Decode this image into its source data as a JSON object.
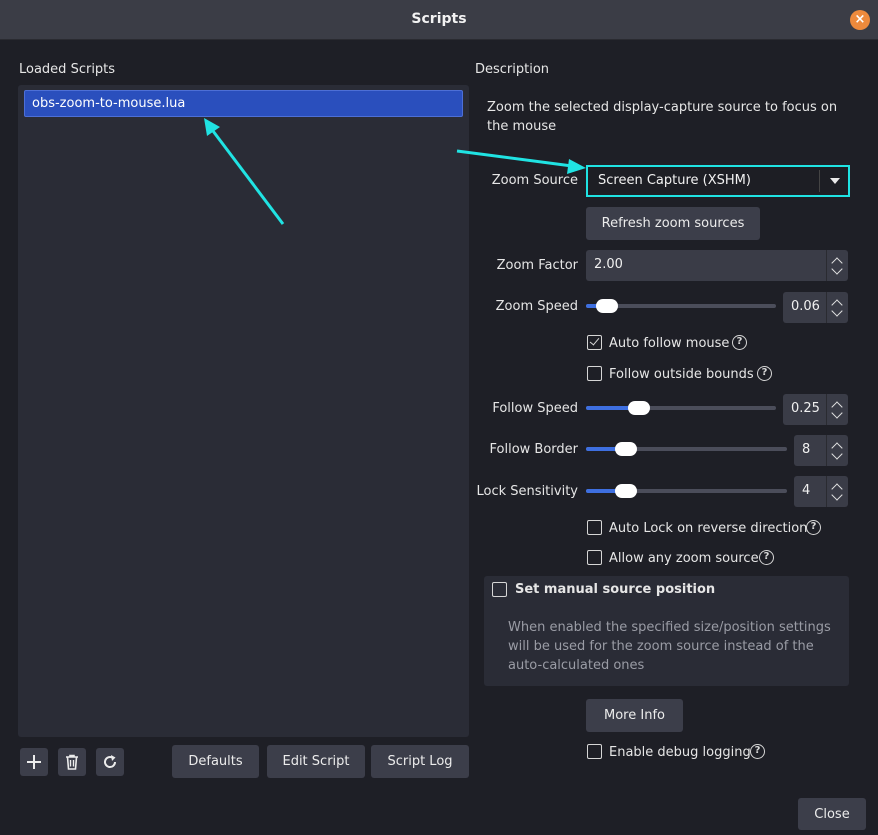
{
  "window": {
    "title": "Scripts",
    "close_glyph": "×"
  },
  "loaded_scripts": {
    "label": "Loaded Scripts",
    "items": [
      {
        "name": "obs-zoom-to-mouse.lua",
        "selected": true
      }
    ]
  },
  "toolbar": {
    "add_icon": "plus-icon",
    "remove_icon": "trash-icon",
    "reload_icon": "reload-icon",
    "defaults_label": "Defaults",
    "edit_script_label": "Edit Script",
    "script_log_label": "Script Log"
  },
  "description": {
    "label": "Description",
    "text": "Zoom the selected display-capture source to focus on the mouse"
  },
  "settings": {
    "zoom_source": {
      "label": "Zoom Source",
      "value": "Screen Capture (XSHM)"
    },
    "refresh_label": "Refresh zoom sources",
    "zoom_factor": {
      "label": "Zoom Factor",
      "value": "2.00"
    },
    "zoom_speed": {
      "label": "Zoom Speed",
      "value": "0.06",
      "level": 0.06
    },
    "auto_follow_mouse": {
      "label": "Auto follow mouse",
      "checked": true
    },
    "follow_outside_bounds": {
      "label": "Follow outside bounds",
      "checked": false
    },
    "follow_speed": {
      "label": "Follow Speed",
      "value": "0.25",
      "level": 0.25
    },
    "follow_border": {
      "label": "Follow Border",
      "value": "8",
      "level": 0.16
    },
    "lock_sensitivity": {
      "label": "Lock Sensitivity",
      "value": "4",
      "level": 0.16
    },
    "auto_lock_reverse": {
      "label": "Auto Lock on reverse direction",
      "checked": false
    },
    "allow_any_zoom_source": {
      "label": "Allow any zoom source",
      "checked": false
    },
    "manual_position": {
      "label": "Set manual source position",
      "checked": false,
      "note": "When enabled the specified size/position settings will be used for the zoom source instead of the auto-calculated ones"
    },
    "more_info_label": "More Info",
    "debug_logging": {
      "label": "Enable debug logging",
      "checked": false
    }
  },
  "footer": {
    "close_label": "Close"
  },
  "colors": {
    "accent": "#2a4fbd",
    "highlight": "#1fe3e3",
    "slider_fill": "#3e6fe0",
    "close_badge": "#ee8a3c"
  }
}
